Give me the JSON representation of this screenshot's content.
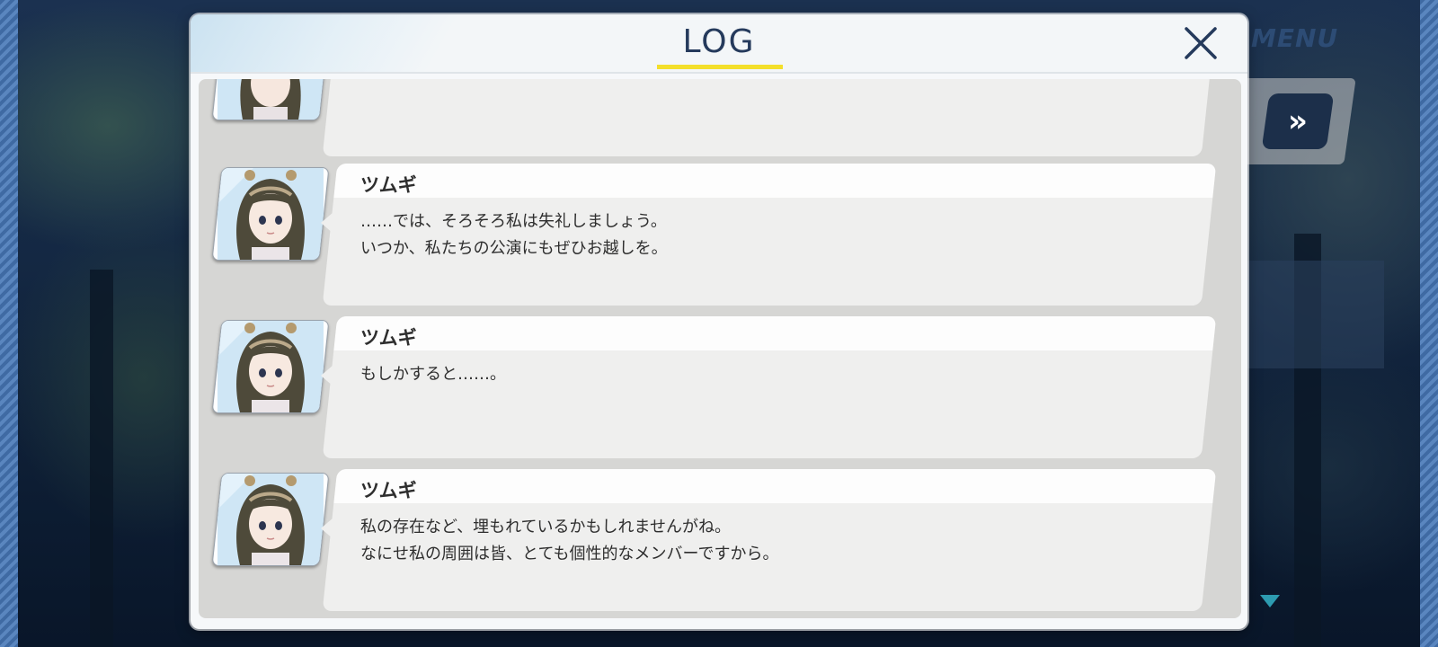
{
  "window": {
    "title": "LOG",
    "close_icon": "close-icon",
    "accent_underline": "#f3df2b",
    "title_color": "#253a5c"
  },
  "overlay": {
    "menu_label": "MENU",
    "fast_forward_icon": "double-chevron-right-icon",
    "fast_forward_glyph": "»",
    "scroll_indicator_icon": "triangle-down-icon"
  },
  "log": {
    "partial_entry": {
      "portrait_icon": "character-portrait-icon"
    },
    "entries": [
      {
        "speaker": "ツムギ",
        "lines": [
          "……では、そろそろ私は失礼しましょう。",
          "いつか、私たちの公演にもぜひお越しを。"
        ]
      },
      {
        "speaker": "ツムギ",
        "lines": [
          "もしかすると……。"
        ]
      },
      {
        "speaker": "ツムギ",
        "lines": [
          "私の存在など、埋もれているかもしれませんがね。",
          "なにせ私の周囲は皆、とても個性的なメンバーですから。"
        ]
      }
    ]
  }
}
